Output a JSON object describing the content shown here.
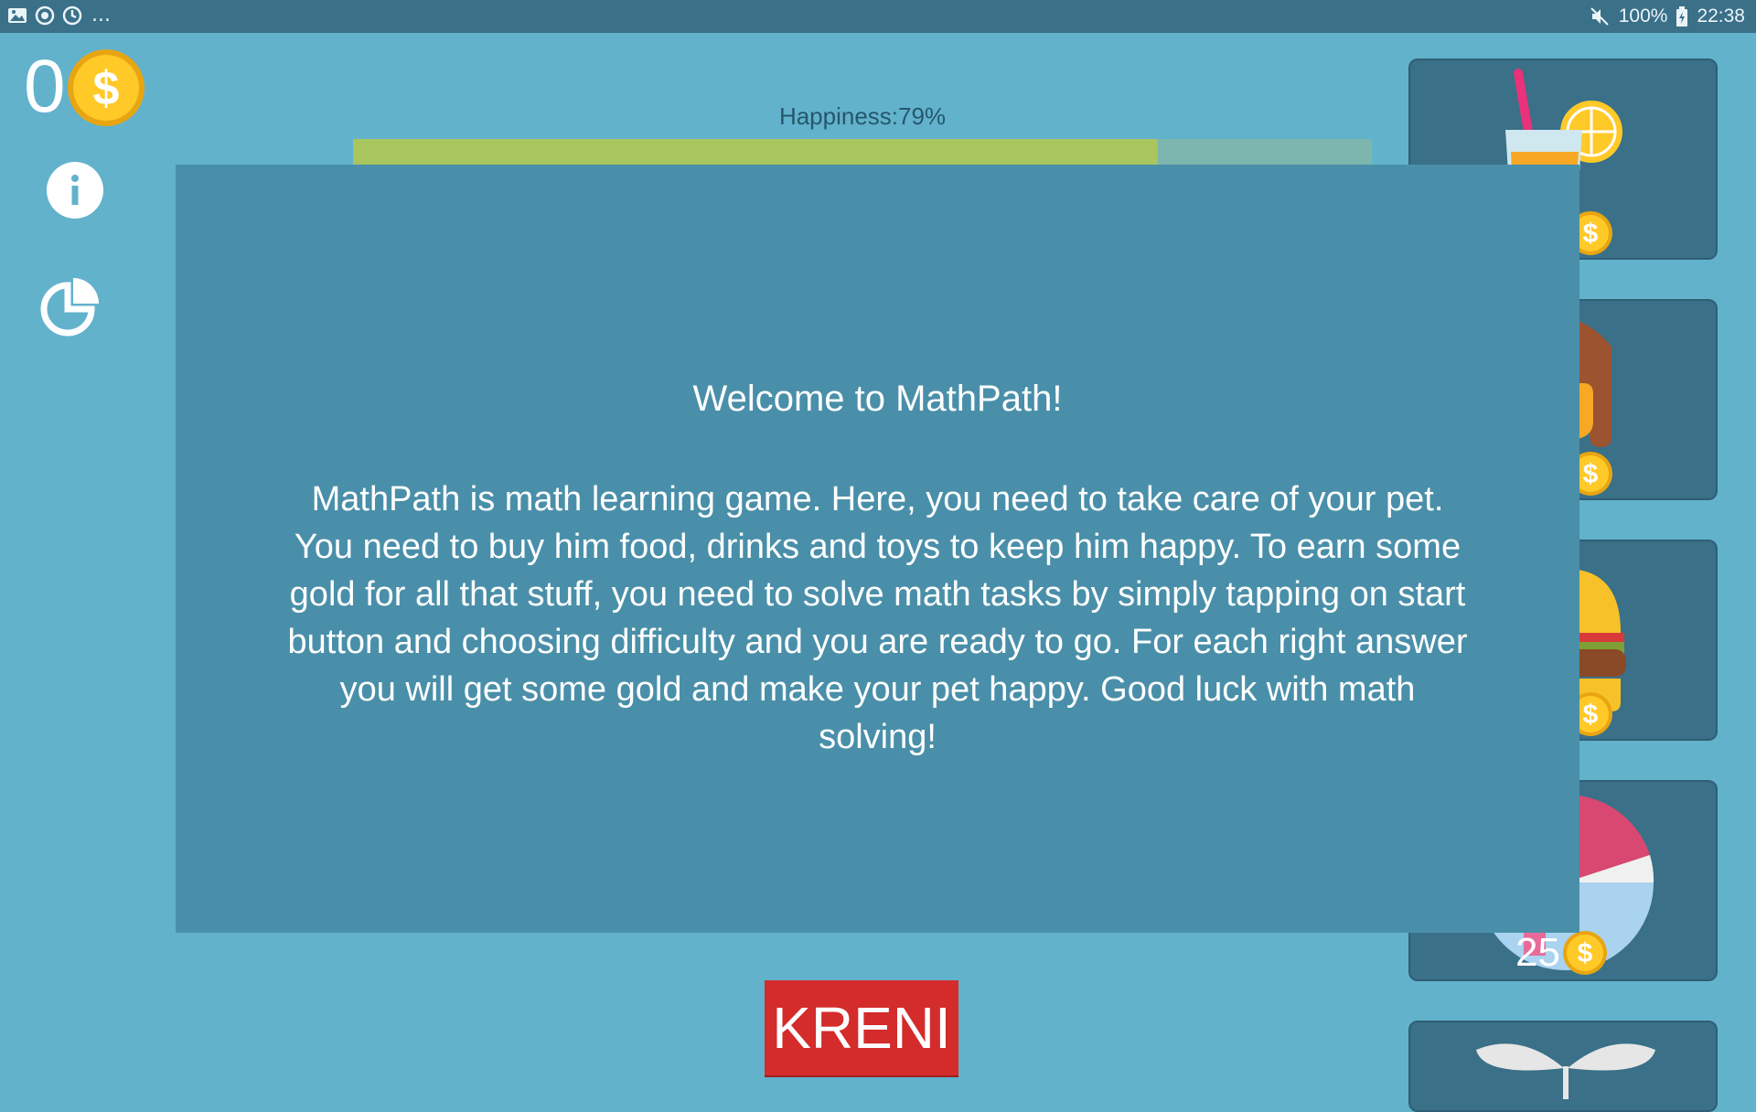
{
  "status_bar": {
    "left_icons": [
      "image-icon",
      "sync-icon",
      "sync-icon"
    ],
    "overflow": "...",
    "icons_right": [
      "mute-icon",
      "battery-icon"
    ],
    "battery": "100%",
    "time": "22:38"
  },
  "wallet": {
    "coins": "0",
    "coin_icon": "dollar-coin-icon"
  },
  "side_buttons": [
    {
      "name": "info-button",
      "icon": "info-icon"
    },
    {
      "name": "stats-button",
      "icon": "pie-chart-icon"
    }
  ],
  "happiness": {
    "label": "Happiness:79%",
    "level": 0.79,
    "fill_color": "#a8c55e"
  },
  "shop": {
    "items": [
      {
        "icon": "lemonade-icon"
      },
      {
        "icon": "ice-cream-icon"
      },
      {
        "icon": "burger-icon"
      },
      {
        "icon": "beach-ball-icon",
        "price": "25"
      },
      {
        "icon": "sprout-icon"
      }
    ]
  },
  "dialog": {
    "title": "Welcome to MathPath!",
    "body": "MathPath is math learning game. Here, you need to take care of your pet. You need to buy him food, drinks and toys to keep him happy. To earn some gold for all that stuff, you need to solve math tasks by simply tapping on start button and choosing difficulty and you are ready to go. For each right answer you will get some gold and make your pet happy. Good luck with math solving!"
  },
  "go_button": {
    "label": "KRENI"
  },
  "colors": {
    "background": "#62b2cc",
    "dialog": "#4a8fa9",
    "card": "#3a7088",
    "button": "#d42b2b"
  }
}
